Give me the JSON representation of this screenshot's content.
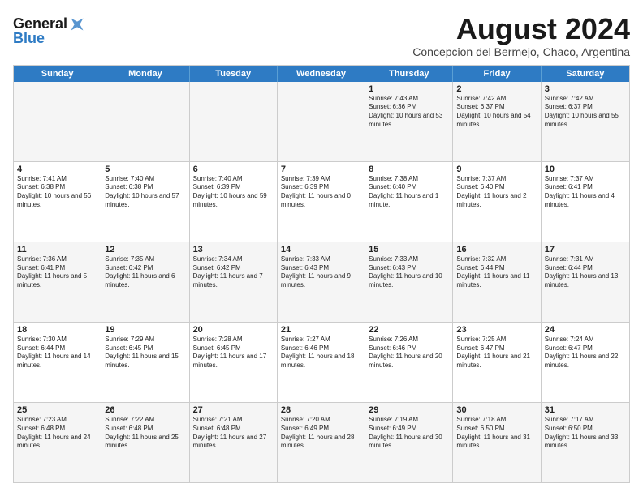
{
  "logo": {
    "line1": "General",
    "line2": "Blue"
  },
  "title": "August 2024",
  "subtitle": "Concepcion del Bermejo, Chaco, Argentina",
  "days": [
    "Sunday",
    "Monday",
    "Tuesday",
    "Wednesday",
    "Thursday",
    "Friday",
    "Saturday"
  ],
  "rows": [
    [
      {
        "day": "",
        "content": ""
      },
      {
        "day": "",
        "content": ""
      },
      {
        "day": "",
        "content": ""
      },
      {
        "day": "",
        "content": ""
      },
      {
        "day": "1",
        "content": "Sunrise: 7:43 AM\nSunset: 6:36 PM\nDaylight: 10 hours and 53 minutes."
      },
      {
        "day": "2",
        "content": "Sunrise: 7:42 AM\nSunset: 6:37 PM\nDaylight: 10 hours and 54 minutes."
      },
      {
        "day": "3",
        "content": "Sunrise: 7:42 AM\nSunset: 6:37 PM\nDaylight: 10 hours and 55 minutes."
      }
    ],
    [
      {
        "day": "4",
        "content": "Sunrise: 7:41 AM\nSunset: 6:38 PM\nDaylight: 10 hours and 56 minutes."
      },
      {
        "day": "5",
        "content": "Sunrise: 7:40 AM\nSunset: 6:38 PM\nDaylight: 10 hours and 57 minutes."
      },
      {
        "day": "6",
        "content": "Sunrise: 7:40 AM\nSunset: 6:39 PM\nDaylight: 10 hours and 59 minutes."
      },
      {
        "day": "7",
        "content": "Sunrise: 7:39 AM\nSunset: 6:39 PM\nDaylight: 11 hours and 0 minutes."
      },
      {
        "day": "8",
        "content": "Sunrise: 7:38 AM\nSunset: 6:40 PM\nDaylight: 11 hours and 1 minute."
      },
      {
        "day": "9",
        "content": "Sunrise: 7:37 AM\nSunset: 6:40 PM\nDaylight: 11 hours and 2 minutes."
      },
      {
        "day": "10",
        "content": "Sunrise: 7:37 AM\nSunset: 6:41 PM\nDaylight: 11 hours and 4 minutes."
      }
    ],
    [
      {
        "day": "11",
        "content": "Sunrise: 7:36 AM\nSunset: 6:41 PM\nDaylight: 11 hours and 5 minutes."
      },
      {
        "day": "12",
        "content": "Sunrise: 7:35 AM\nSunset: 6:42 PM\nDaylight: 11 hours and 6 minutes."
      },
      {
        "day": "13",
        "content": "Sunrise: 7:34 AM\nSunset: 6:42 PM\nDaylight: 11 hours and 7 minutes."
      },
      {
        "day": "14",
        "content": "Sunrise: 7:33 AM\nSunset: 6:43 PM\nDaylight: 11 hours and 9 minutes."
      },
      {
        "day": "15",
        "content": "Sunrise: 7:33 AM\nSunset: 6:43 PM\nDaylight: 11 hours and 10 minutes."
      },
      {
        "day": "16",
        "content": "Sunrise: 7:32 AM\nSunset: 6:44 PM\nDaylight: 11 hours and 11 minutes."
      },
      {
        "day": "17",
        "content": "Sunrise: 7:31 AM\nSunset: 6:44 PM\nDaylight: 11 hours and 13 minutes."
      }
    ],
    [
      {
        "day": "18",
        "content": "Sunrise: 7:30 AM\nSunset: 6:44 PM\nDaylight: 11 hours and 14 minutes."
      },
      {
        "day": "19",
        "content": "Sunrise: 7:29 AM\nSunset: 6:45 PM\nDaylight: 11 hours and 15 minutes."
      },
      {
        "day": "20",
        "content": "Sunrise: 7:28 AM\nSunset: 6:45 PM\nDaylight: 11 hours and 17 minutes."
      },
      {
        "day": "21",
        "content": "Sunrise: 7:27 AM\nSunset: 6:46 PM\nDaylight: 11 hours and 18 minutes."
      },
      {
        "day": "22",
        "content": "Sunrise: 7:26 AM\nSunset: 6:46 PM\nDaylight: 11 hours and 20 minutes."
      },
      {
        "day": "23",
        "content": "Sunrise: 7:25 AM\nSunset: 6:47 PM\nDaylight: 11 hours and 21 minutes."
      },
      {
        "day": "24",
        "content": "Sunrise: 7:24 AM\nSunset: 6:47 PM\nDaylight: 11 hours and 22 minutes."
      }
    ],
    [
      {
        "day": "25",
        "content": "Sunrise: 7:23 AM\nSunset: 6:48 PM\nDaylight: 11 hours and 24 minutes."
      },
      {
        "day": "26",
        "content": "Sunrise: 7:22 AM\nSunset: 6:48 PM\nDaylight: 11 hours and 25 minutes."
      },
      {
        "day": "27",
        "content": "Sunrise: 7:21 AM\nSunset: 6:48 PM\nDaylight: 11 hours and 27 minutes."
      },
      {
        "day": "28",
        "content": "Sunrise: 7:20 AM\nSunset: 6:49 PM\nDaylight: 11 hours and 28 minutes."
      },
      {
        "day": "29",
        "content": "Sunrise: 7:19 AM\nSunset: 6:49 PM\nDaylight: 11 hours and 30 minutes."
      },
      {
        "day": "30",
        "content": "Sunrise: 7:18 AM\nSunset: 6:50 PM\nDaylight: 11 hours and 31 minutes."
      },
      {
        "day": "31",
        "content": "Sunrise: 7:17 AM\nSunset: 6:50 PM\nDaylight: 11 hours and 33 minutes."
      }
    ]
  ]
}
